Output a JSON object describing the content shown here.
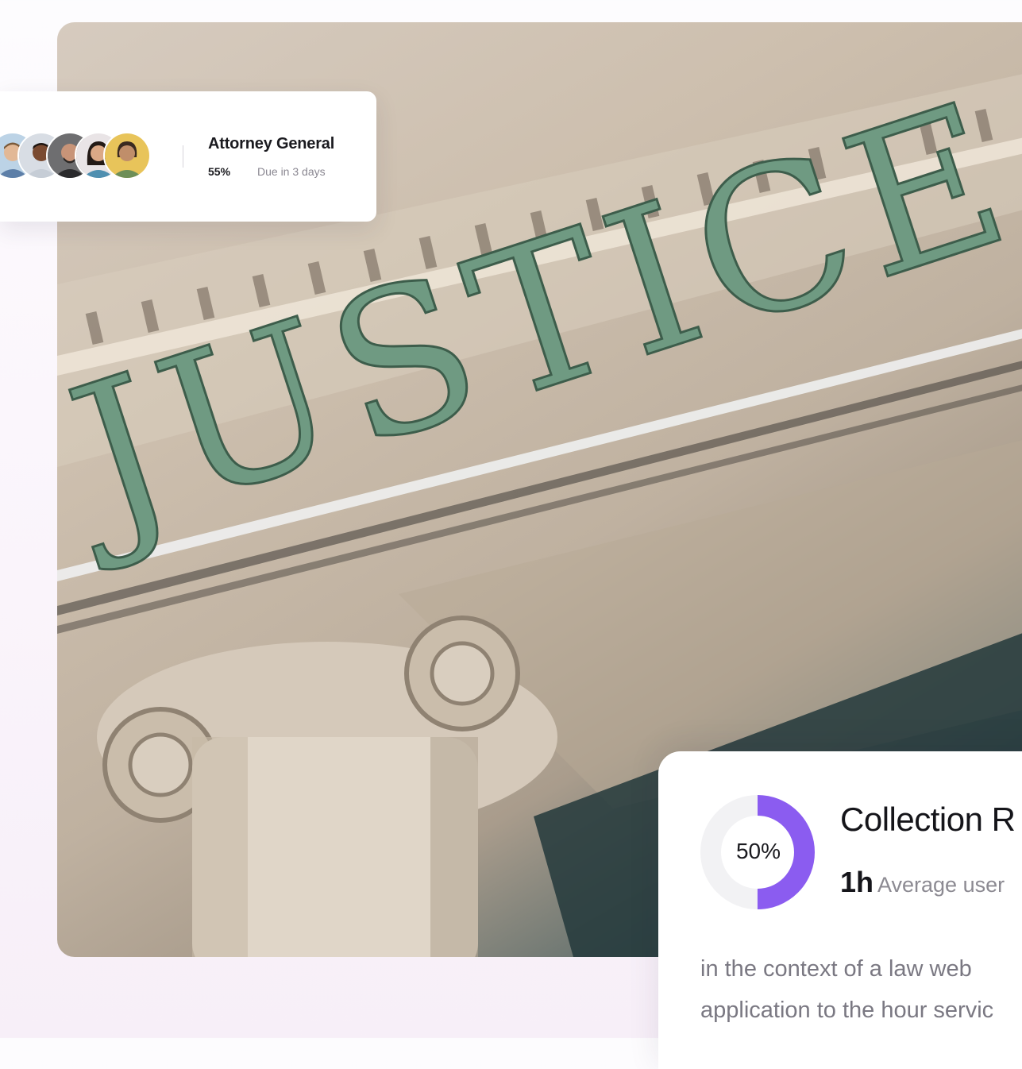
{
  "hero_image": {
    "engraved_text": "JUSTICE",
    "alt": "Courthouse facade"
  },
  "task_card": {
    "title": "Attorney General",
    "progress_percent": "55%",
    "progress_value": 55,
    "due": "Due in 3 days",
    "avatars": [
      {
        "name": "team-member-1",
        "skin": "#e2b896",
        "hair": "#7a5a3a",
        "bg": "#bcd3e6"
      },
      {
        "name": "team-member-2",
        "skin": "#7a4a30",
        "hair": "#1d1410",
        "bg": "#d8dde4"
      },
      {
        "name": "team-member-3",
        "skin": "#c89478",
        "hair": "#2a2624",
        "bg": "#6e6e70"
      },
      {
        "name": "team-member-4",
        "skin": "#dba886",
        "hair": "#231a16",
        "bg": "#e9e4e6"
      },
      {
        "name": "team-member-5",
        "skin": "#c08e6a",
        "hair": "#3a2a20",
        "bg": "#e8c45a"
      }
    ]
  },
  "stat_card": {
    "donut_label": "50%",
    "donut_value": 50,
    "title": "Collection R",
    "value": "1h",
    "unit_text": "Average user",
    "description_line1": "in the context of a law web",
    "description_line2": "application to the hour servic",
    "accent_color": "#8b5cf0",
    "track_color": "#f2f2f4"
  }
}
